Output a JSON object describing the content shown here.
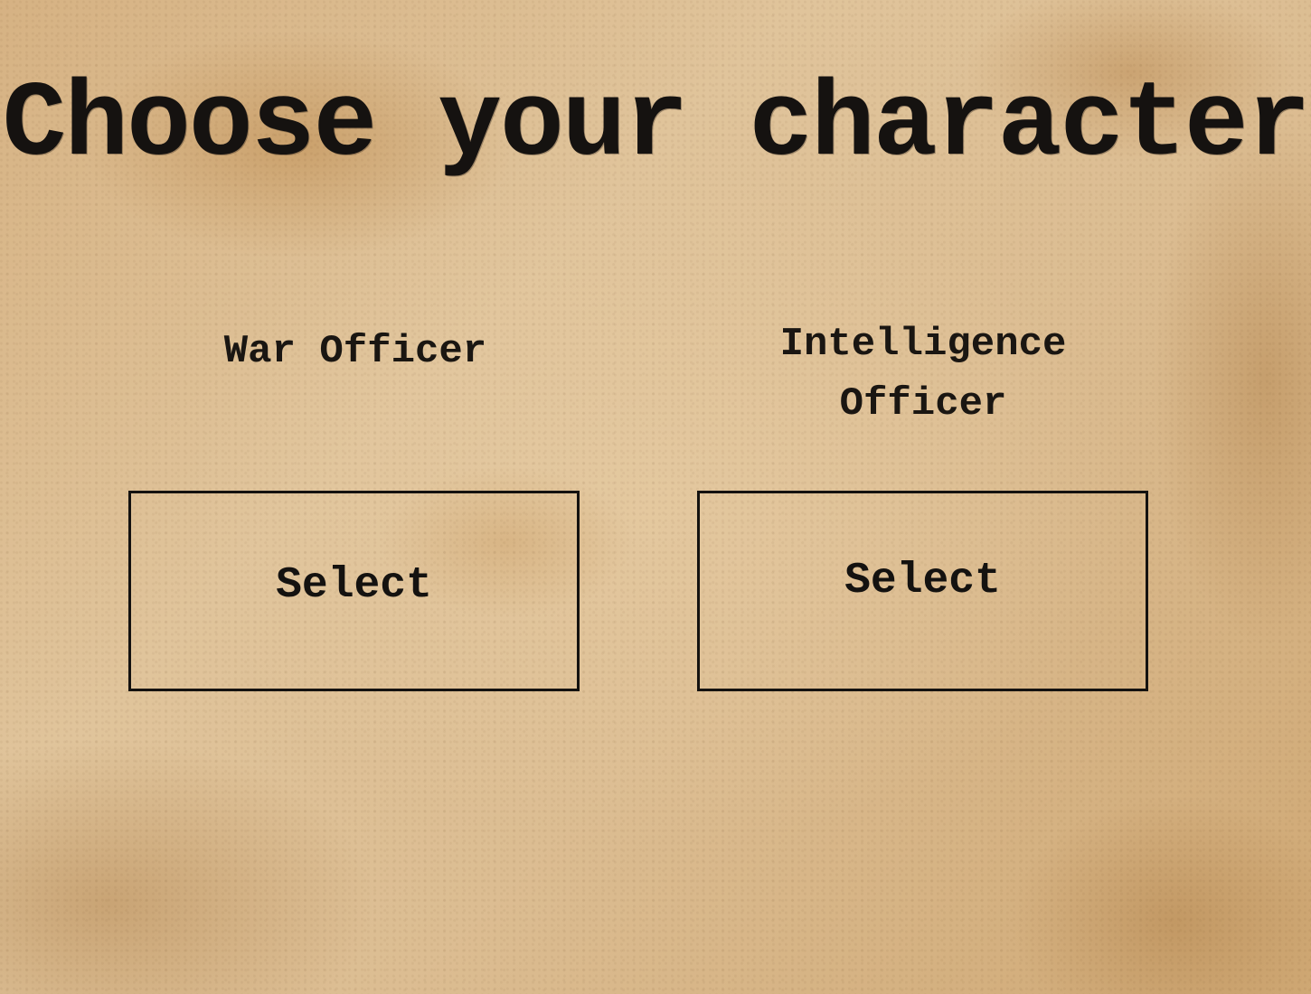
{
  "screen": {
    "title": "Choose your character"
  },
  "characters": [
    {
      "name": "War Officer",
      "select_label": "Select"
    },
    {
      "name": "Intelligence Officer",
      "select_label": "Select"
    }
  ],
  "colors": {
    "paper": "#d9b98c",
    "ink": "#141210"
  }
}
